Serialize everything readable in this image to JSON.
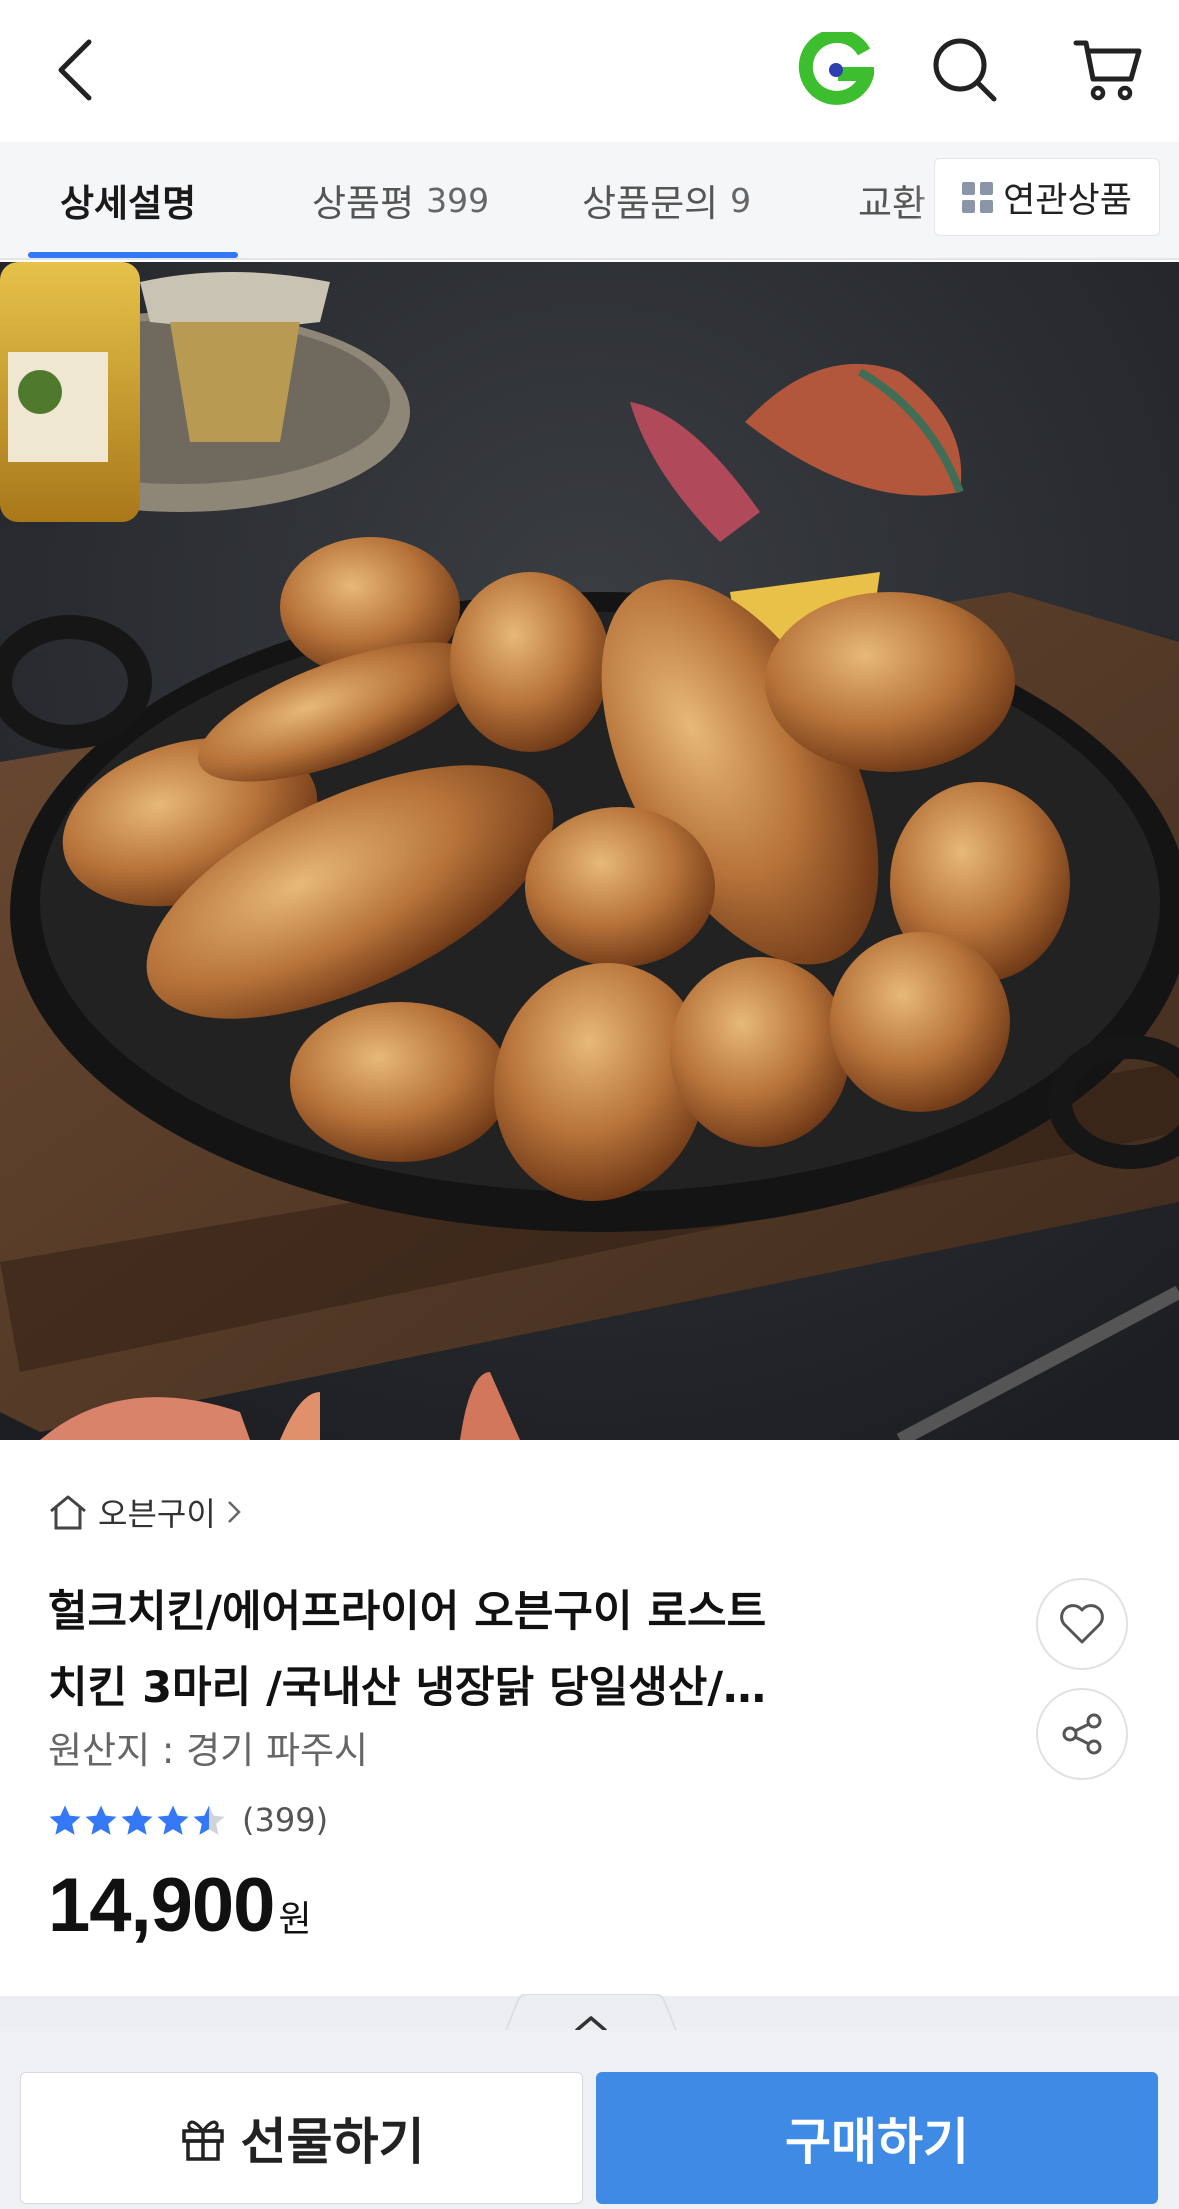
{
  "header": {
    "logo_letter": "G",
    "logo_color": "#3cbe2e",
    "logo_dot_color": "#2d3eb0"
  },
  "tabs": [
    {
      "label": "상세설명",
      "count": "",
      "active": true
    },
    {
      "label": "상품평",
      "count": "399",
      "active": false
    },
    {
      "label": "상품문의",
      "count": "9",
      "active": false
    },
    {
      "label": "교환",
      "count": "",
      "active": false
    }
  ],
  "related": {
    "label": "연관상품"
  },
  "accent_color": "#3478f6",
  "product": {
    "shop_name": "오븐구이",
    "title_line1": "헐크치킨/에어프라이어 오븐구이 로스트",
    "title_line2": "치킨 3마리 /국내산 냉장닭 당일생산/…",
    "origin": "원산지 : 경기 파주시",
    "rating": 4.5,
    "rating_count": "(399)",
    "price": "14,900",
    "price_unit": "원"
  },
  "bottom": {
    "gift_label": "선물하기",
    "buy_label": "구매하기",
    "buy_color": "#3f8ae4"
  }
}
